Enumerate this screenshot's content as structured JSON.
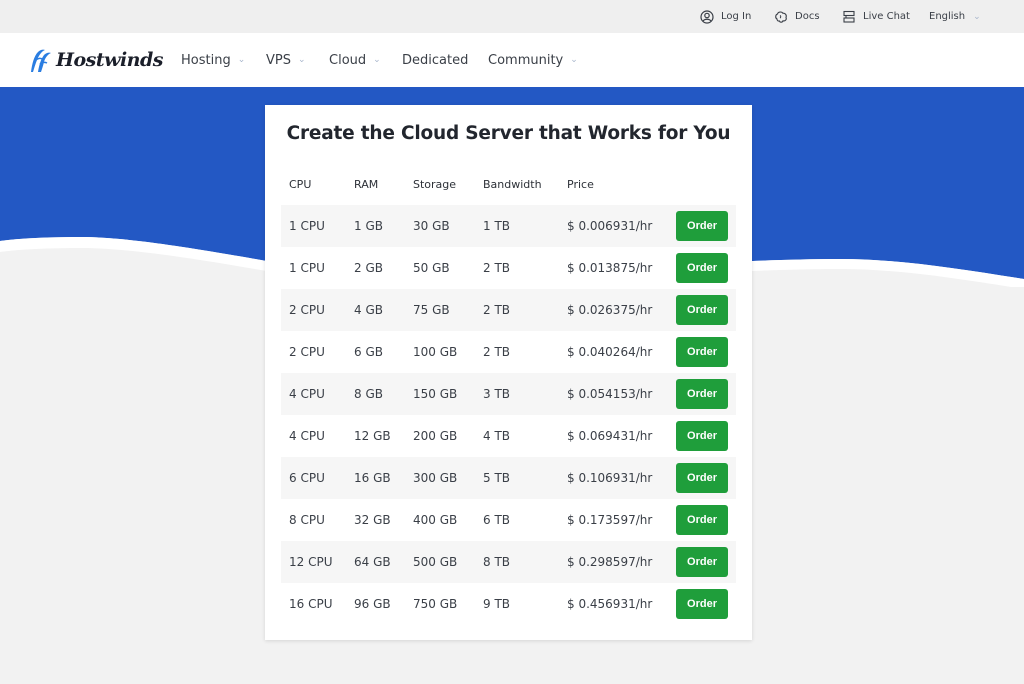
{
  "topbar": {
    "login": "Log In",
    "docs": "Docs",
    "live_chat": "Live Chat",
    "language": "English"
  },
  "brand": {
    "name": "Hostwinds",
    "primary_color": "#2358c4",
    "button_color": "#1f9e3b"
  },
  "nav": {
    "items": [
      {
        "label": "Hosting",
        "has_dropdown": true
      },
      {
        "label": "VPS",
        "has_dropdown": true
      },
      {
        "label": "Cloud",
        "has_dropdown": true
      },
      {
        "label": "Dedicated",
        "has_dropdown": false
      },
      {
        "label": "Community",
        "has_dropdown": true
      }
    ]
  },
  "pricing": {
    "title": "Create the Cloud Server that Works for You",
    "headers": [
      "CPU",
      "RAM",
      "Storage",
      "Bandwidth",
      "Price"
    ],
    "order_label": "Order",
    "rows": [
      {
        "cpu": "1 CPU",
        "ram": "1 GB",
        "storage": "30 GB",
        "bandwidth": "1 TB",
        "price": "$ 0.006931/hr"
      },
      {
        "cpu": "1 CPU",
        "ram": "2 GB",
        "storage": "50 GB",
        "bandwidth": "2 TB",
        "price": "$ 0.013875/hr"
      },
      {
        "cpu": "2 CPU",
        "ram": "4 GB",
        "storage": "75 GB",
        "bandwidth": "2 TB",
        "price": "$ 0.026375/hr"
      },
      {
        "cpu": "2 CPU",
        "ram": "6 GB",
        "storage": "100 GB",
        "bandwidth": "2 TB",
        "price": "$ 0.040264/hr"
      },
      {
        "cpu": "4 CPU",
        "ram": "8 GB",
        "storage": "150 GB",
        "bandwidth": "3 TB",
        "price": "$ 0.054153/hr"
      },
      {
        "cpu": "4 CPU",
        "ram": "12 GB",
        "storage": "200 GB",
        "bandwidth": "4 TB",
        "price": "$ 0.069431/hr"
      },
      {
        "cpu": "6 CPU",
        "ram": "16 GB",
        "storage": "300 GB",
        "bandwidth": "5 TB",
        "price": "$ 0.106931/hr"
      },
      {
        "cpu": "8 CPU",
        "ram": "32 GB",
        "storage": "400 GB",
        "bandwidth": "6 TB",
        "price": "$ 0.173597/hr"
      },
      {
        "cpu": "12 CPU",
        "ram": "64 GB",
        "storage": "500 GB",
        "bandwidth": "8 TB",
        "price": "$ 0.298597/hr"
      },
      {
        "cpu": "16 CPU",
        "ram": "96 GB",
        "storage": "750 GB",
        "bandwidth": "9 TB",
        "price": "$ 0.456931/hr"
      }
    ]
  }
}
